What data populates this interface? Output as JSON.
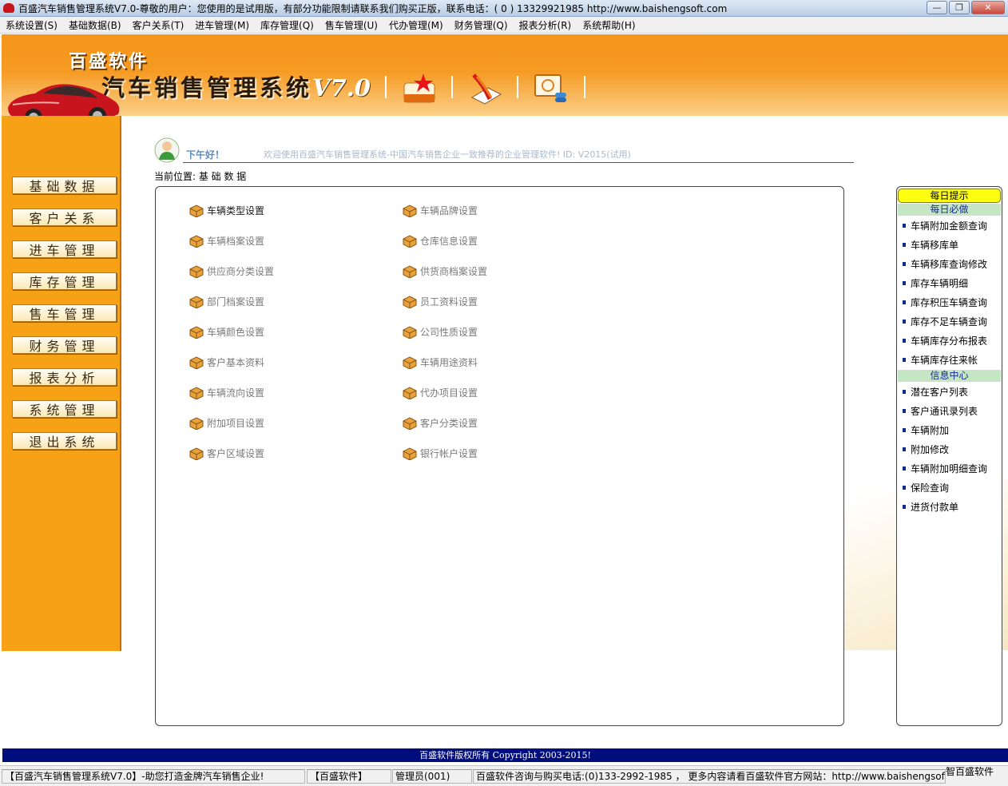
{
  "window": {
    "title": "百盛汽车销售管理系统V7.0-尊敬的用户：您使用的是试用版，有部分功能限制请联系我们购买正版，联系电话：( 0 ) 13329921985  http://www.baishengsoft.com",
    "minimize": "—",
    "maximize": "❐",
    "close": "✕"
  },
  "menu": [
    "系统设置(S)",
    "基础数据(B)",
    "客户关系(T)",
    "进车管理(M)",
    "库存管理(Q)",
    "售车管理(U)",
    "代办管理(M)",
    "财务管理(Q)",
    "报表分析(R)",
    "系统帮助(H)"
  ],
  "banner": {
    "brand_small": "百盛软件",
    "brand_big": "汽车销售管理系统",
    "version": "V7.0"
  },
  "sidebar": [
    "基础数据",
    "客户关系",
    "进车管理",
    "库存管理",
    "售车管理",
    "财务管理",
    "报表分析",
    "系统管理",
    "退出系统"
  ],
  "greeting": {
    "label": "下午好！",
    "text": "欢迎使用百盛汽车销售管理系统-中国汽车销售企业一致推荐的企业管理软件! ID: V2015(试用)"
  },
  "location": "当前位置: 基 础 数 据",
  "functions_left": [
    "车辆类型设置",
    "车辆档案设置",
    "供应商分类设置",
    "部门档案设置",
    "车辆颜色设置",
    "客户基本资料",
    "车辆流向设置",
    "附加项目设置",
    "客户区域设置"
  ],
  "functions_right": [
    "车辆品牌设置",
    "仓库信息设置",
    "供货商档案设置",
    "员工资料设置",
    "公司性质设置",
    "车辆用途资料",
    "代办项目设置",
    "客户分类设置",
    "银行帐户设置"
  ],
  "right_panel": {
    "header": "每日提示",
    "daily_title": "每日必做",
    "daily_items": [
      "车辆附加金额查询",
      "车辆移库单",
      "车辆移库查询修改",
      "库存车辆明细",
      "库存积压车辆查询",
      "库存不足车辆查询",
      "车辆库存分布报表",
      "车辆库存往来帐"
    ],
    "info_title": "信息中心",
    "info_items": [
      "潜在客户列表",
      "客户通讯录列表",
      "车辆附加",
      "附加修改",
      "车辆附加明细查询",
      "保险查询",
      "进货付款单"
    ]
  },
  "footer": {
    "copyright": "百盛软件版权所有 Copyright 2003-2015!",
    "status_1": "【百盛汽车销售管理系统V7.0】-助您打造金牌汽车销售企业!",
    "status_2": "【百盛软件】",
    "status_3": "管理员(001)",
    "status_4": "百盛软件咨询与购买电话:(0)133-2992-1985 ， 更多内容请看百盛软件官方网站：http://www.baishengsoft.com",
    "corner": "智百盛软件"
  },
  "colors": {
    "banner_orange": "#f7961b",
    "sidebar_orange": "#f7a116",
    "copyright_bar": "#000d7d",
    "tip_yellow": "#fefe10",
    "section_green": "#c5e6c5"
  }
}
